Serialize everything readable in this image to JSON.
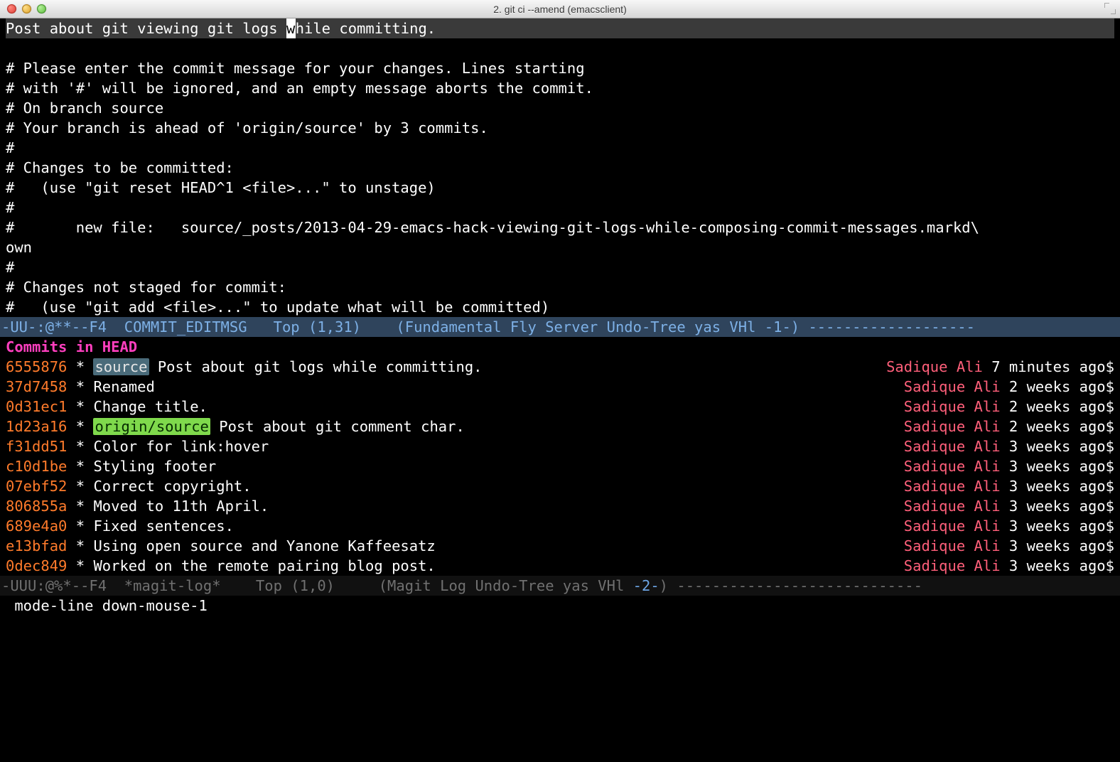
{
  "window": {
    "title": "2. git ci --amend (emacsclient)"
  },
  "buffer": {
    "first_line_pre": "Post about git viewing git logs ",
    "first_line_cursor": "w",
    "first_line_post": "hile committing.",
    "comments": [
      "",
      "# Please enter the commit message for your changes. Lines starting",
      "# with '#' will be ignored, and an empty message aborts the commit.",
      "# On branch source",
      "# Your branch is ahead of 'origin/source' by 3 commits.",
      "#",
      "# Changes to be committed:",
      "#   (use \"git reset HEAD^1 <file>...\" to unstage)",
      "#",
      "#       new file:   source/_posts/2013-04-29-emacs-hack-viewing-git-logs-while-composing-commit-messages.markd\\",
      "own",
      "#",
      "# Changes not staged for commit:",
      "#   (use \"git add <file>...\" to update what will be committed)"
    ]
  },
  "modeline_top": "-UU-:@**--F4  COMMIT_EDITMSG   Top (1,31)    (Fundamental Fly Server Undo-Tree yas VHl -1-) -------------------",
  "log": {
    "heading": "Commits in HEAD",
    "rows": [
      {
        "sha": "6555876",
        "branch": "source",
        "branch_type": "local",
        "msg": "Post about git logs while committing.",
        "author": "Sadique Ali",
        "when": "7 minutes ago"
      },
      {
        "sha": "37d7458",
        "branch": "",
        "branch_type": "",
        "msg": "Renamed",
        "author": "Sadique Ali",
        "when": "2 weeks ago"
      },
      {
        "sha": "0d31ec1",
        "branch": "",
        "branch_type": "",
        "msg": "Change title.",
        "author": "Sadique Ali",
        "when": "2 weeks ago"
      },
      {
        "sha": "1d23a16",
        "branch": "origin/source",
        "branch_type": "remote",
        "msg": "Post about git comment char.",
        "author": "Sadique Ali",
        "when": "2 weeks ago"
      },
      {
        "sha": "f31dd51",
        "branch": "",
        "branch_type": "",
        "msg": "Color for link:hover",
        "author": "Sadique Ali",
        "when": "3 weeks ago"
      },
      {
        "sha": "c10d1be",
        "branch": "",
        "branch_type": "",
        "msg": "Styling footer",
        "author": "Sadique Ali",
        "when": "3 weeks ago"
      },
      {
        "sha": "07ebf52",
        "branch": "",
        "branch_type": "",
        "msg": "Correct copyright.",
        "author": "Sadique Ali",
        "when": "3 weeks ago"
      },
      {
        "sha": "806855a",
        "branch": "",
        "branch_type": "",
        "msg": "Moved to 11th April.",
        "author": "Sadique Ali",
        "when": "3 weeks ago"
      },
      {
        "sha": "689e4a0",
        "branch": "",
        "branch_type": "",
        "msg": "Fixed sentences.",
        "author": "Sadique Ali",
        "when": "3 weeks ago"
      },
      {
        "sha": "e13bfad",
        "branch": "",
        "branch_type": "",
        "msg": "Using open source and Yanone Kaffeesatz",
        "author": "Sadique Ali",
        "when": "3 weeks ago"
      },
      {
        "sha": "0dec849",
        "branch": "",
        "branch_type": "",
        "msg": "Worked on the remote pairing blog post.",
        "author": "Sadique Ali",
        "when": "3 weeks ago"
      }
    ]
  },
  "modeline_bottom_pre": "-UUU:@%*--F4  *magit-log*    Top (1,0)     (Magit Log Undo-Tree yas VHl ",
  "modeline_bottom_accent": "-2-",
  "modeline_bottom_post": ") ----------------------------",
  "echo": " mode-line down-mouse-1"
}
